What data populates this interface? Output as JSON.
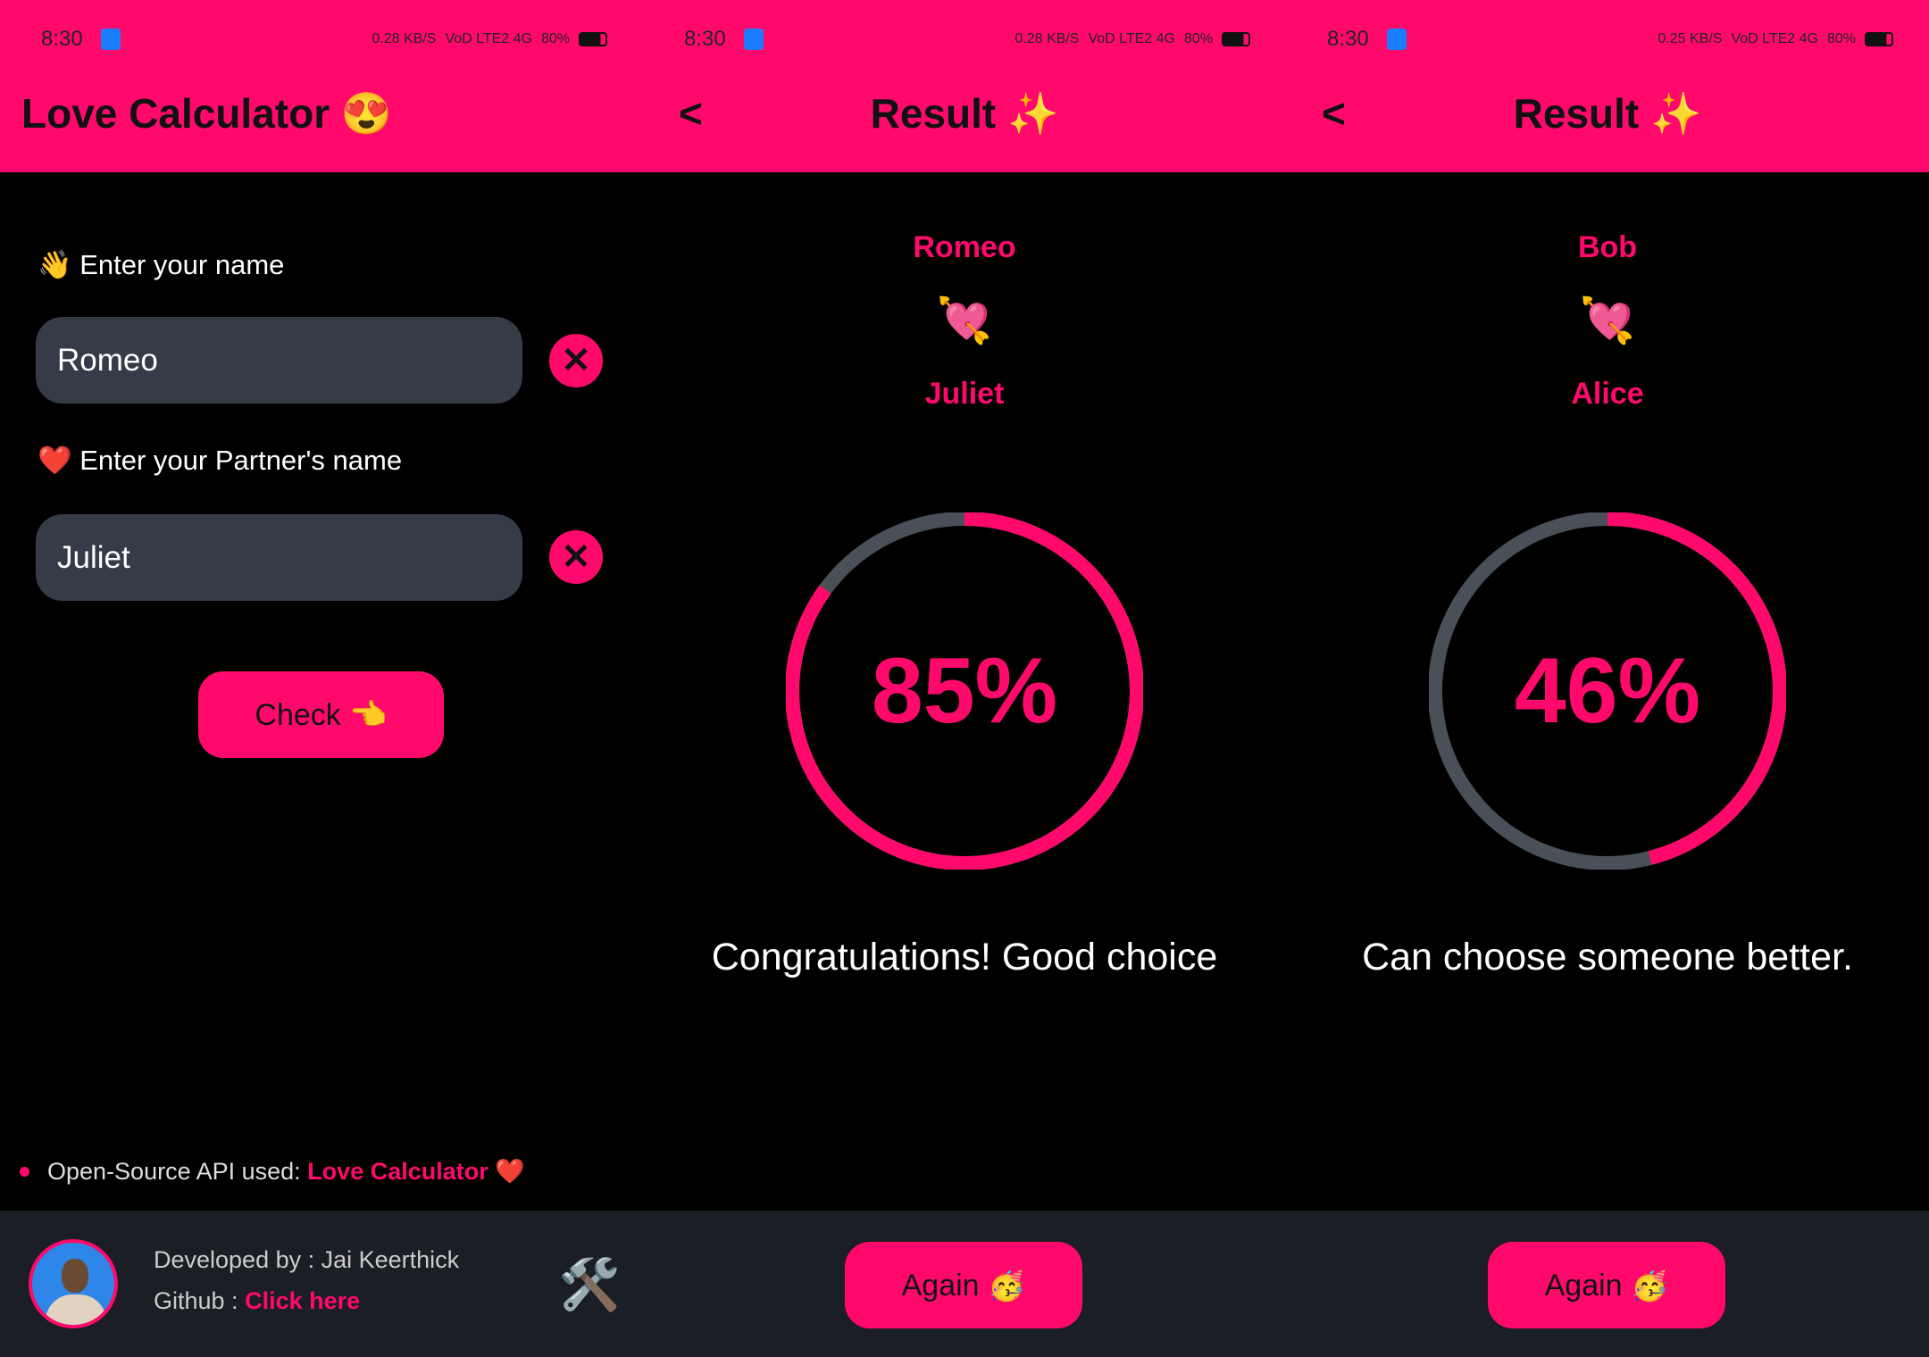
{
  "colors": {
    "accent": "#ff0a6c",
    "track": "#4a5058",
    "input_bg": "#353c48",
    "footer_bg": "#1b1e24"
  },
  "screens": [
    {
      "status": {
        "time": "8:30",
        "speed": "0.28 KB/S",
        "network": "VoD LTE2 4G",
        "battery": "80%"
      },
      "title": "Love Calculator 😍",
      "name_label": "👋 Enter your name",
      "name_value": "Romeo",
      "partner_label": "❤️ Enter your Partner's name",
      "partner_value": "Juliet",
      "check_label": "Check 👈",
      "api_prefix": "Open-Source API used:",
      "api_link": "Love Calculator",
      "api_heart": "❤️",
      "developer": "Developed by : Jai Keerthick",
      "github_prefix": "Github :",
      "github_link": "Click here",
      "tools_icon": "🛠️"
    },
    {
      "status": {
        "time": "8:30",
        "speed": "0.28 KB/S",
        "network": "VoD LTE2 4G",
        "battery": "80%"
      },
      "title": "Result ✨",
      "name1": "Romeo",
      "emoji": "💘",
      "name2": "Juliet",
      "percentage": 85,
      "percentage_text": "85%",
      "message": "Congratulations! Good choice",
      "again_label": "Again 🥳"
    },
    {
      "status": {
        "time": "8:30",
        "speed": "0.25 KB/S",
        "network": "VoD LTE2 4G",
        "battery": "80%"
      },
      "title": "Result ✨",
      "name1": "Bob",
      "emoji": "💘",
      "name2": "Alice",
      "percentage": 46,
      "percentage_text": "46%",
      "message": "Can choose someone better.",
      "again_label": "Again 🥳"
    }
  ]
}
